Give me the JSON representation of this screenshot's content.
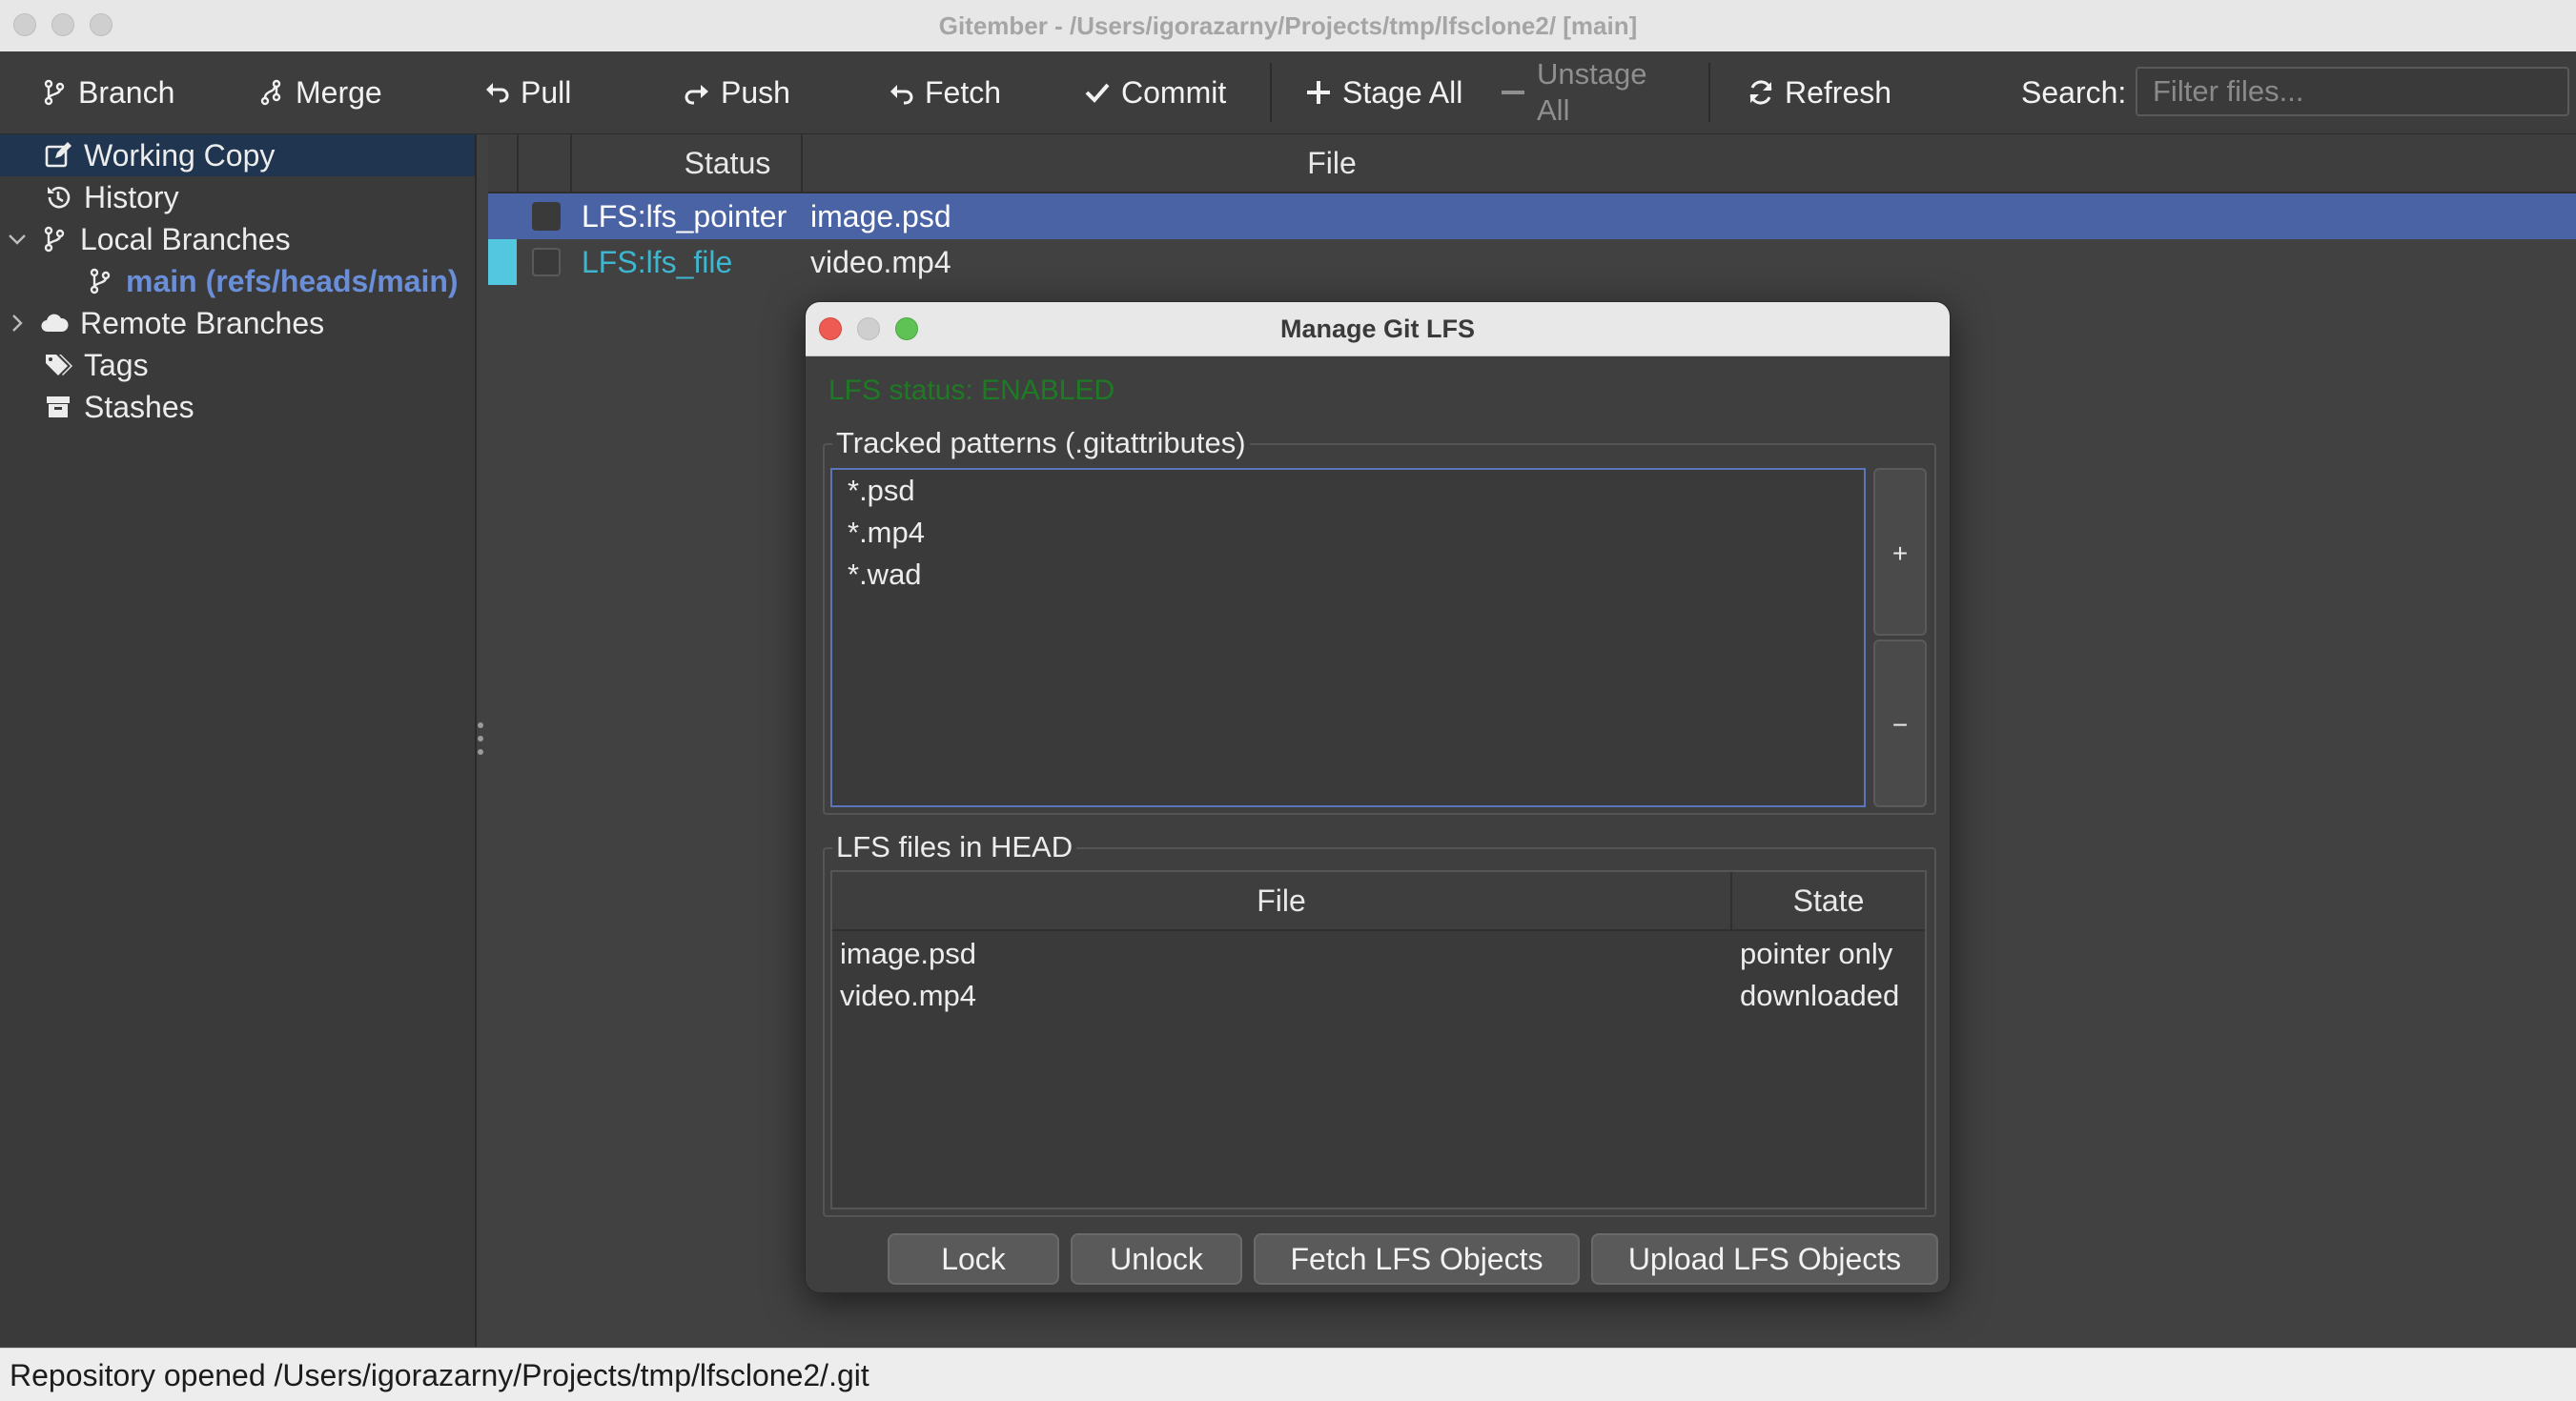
{
  "window": {
    "title": "Gitember - /Users/igorazarny/Projects/tmp/lfsclone2/ [main]"
  },
  "toolbar": {
    "branch": "Branch",
    "merge": "Merge",
    "pull": "Pull",
    "push": "Push",
    "fetch": "Fetch",
    "commit": "Commit",
    "stage_all": "Stage All",
    "unstage_all_1": "Unstage",
    "unstage_all_2": "All",
    "refresh": "Refresh",
    "search_label": "Search:",
    "search_placeholder": "Filter files..."
  },
  "sidebar": {
    "working_copy": "Working Copy",
    "history": "History",
    "local_branches": "Local Branches",
    "main_branch": "main (refs/heads/main)",
    "remote_branches": "Remote Branches",
    "tags": "Tags",
    "stashes": "Stashes"
  },
  "files_table": {
    "headers": {
      "status": "Status",
      "file": "File"
    },
    "rows": [
      {
        "status": "LFS:lfs_pointer",
        "file": "image.psd"
      },
      {
        "status": "LFS:lfs_file",
        "file": "video.mp4"
      }
    ]
  },
  "dialog": {
    "title": "Manage Git LFS",
    "lfs_status": "LFS status: ENABLED",
    "patterns_title": "Tracked patterns (.gitattributes)",
    "patterns": [
      "*.psd",
      "*.mp4",
      "*.wad"
    ],
    "add_label": "+",
    "remove_label": "−",
    "lfs_files_title": "LFS files in HEAD",
    "lfs_files_headers": {
      "file": "File",
      "state": "State"
    },
    "lfs_files": [
      {
        "file": "image.psd",
        "state": "pointer only"
      },
      {
        "file": "video.mp4",
        "state": "downloaded"
      }
    ],
    "buttons": {
      "lock": "Lock",
      "unlock": "Unlock",
      "fetch": "Fetch LFS Objects",
      "upload": "Upload LFS Objects"
    }
  },
  "statusbar": {
    "text": "Repository opened /Users/igorazarny/Projects/tmp/lfsclone2/.git"
  },
  "colors": {
    "selection": "#4a63a5",
    "lfs_file_status": "#3fb6cf",
    "branch_active": "#6a8ed8",
    "lfs_enabled": "#1e7a24"
  }
}
